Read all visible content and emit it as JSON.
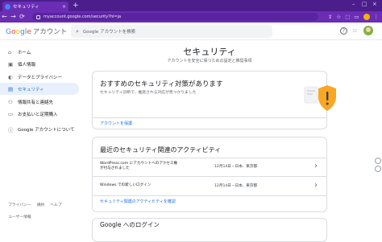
{
  "browser": {
    "tab_title": "セキュリティ",
    "tab_close": "×",
    "new_tab": "+",
    "url": "myaccount.google.com/security?hl=ja",
    "back": "←",
    "forward": "→",
    "reload": "⟳",
    "window_controls": [
      "–",
      "□",
      "×"
    ]
  },
  "header": {
    "brand_g": "G",
    "brand_o1": "o",
    "brand_o2": "o",
    "brand_g2": "g",
    "brand_l": "l",
    "brand_e": "e",
    "brand_suffix": "アカウント",
    "search_placeholder": "Google アカウントを検索"
  },
  "sidebar": {
    "items": [
      {
        "label": "ホーム",
        "icon": "home-icon"
      },
      {
        "label": "個人情報",
        "icon": "person-icon"
      },
      {
        "label": "データとプライバシー",
        "icon": "toggle-icon"
      },
      {
        "label": "セキュリティ",
        "icon": "lock-icon",
        "active": true
      },
      {
        "label": "情報共有と連絡先",
        "icon": "people-icon"
      },
      {
        "label": "お支払いと定期購入",
        "icon": "card-icon"
      },
      {
        "label": "Google アカウントについて",
        "icon": "info-icon"
      }
    ],
    "footer_links": [
      "プライバシー",
      "規約",
      "ヘルプ"
    ],
    "feedback": "ユーザー情報"
  },
  "main": {
    "title": "セキュリティ",
    "subtitle": "アカウントを安全に保つための設定と推奨事項",
    "recommendation_card": {
      "title": "おすすめのセキュリティ対策があります",
      "description": "セキュリティ診断で、推奨される対応が見つかりました",
      "link": "アカウントを保護"
    },
    "activity_card": {
      "title": "最近のセキュリティ関連のアクティビティ",
      "rows": [
        {
          "action": "WordPress.com にアカウントへのアクセス権が付与されました",
          "when": "12月14日・日本、東京都"
        },
        {
          "action": "Windows での新しいログイン",
          "when": "12月14日・日本、東京都"
        }
      ],
      "link": "セキュリティ関連のアクティビティを確認"
    },
    "signin_card": {
      "title": "Google へのログイン"
    }
  },
  "colors": {
    "browser_frame": "#6a2db4",
    "accent": "#1a73e8",
    "active_nav_bg": "#e8f0fe",
    "warning_shield": "#f9a825"
  }
}
